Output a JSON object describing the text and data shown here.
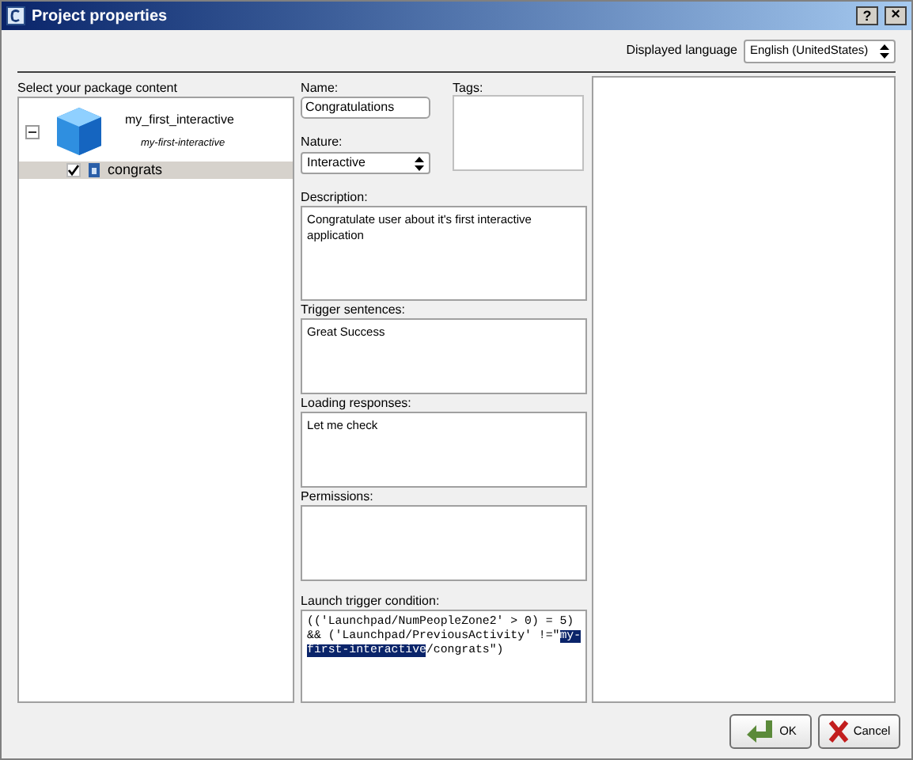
{
  "window": {
    "title": "Project properties",
    "help": "?",
    "close": "×"
  },
  "language": {
    "label": "Displayed language",
    "value": "English (UnitedStates)"
  },
  "package": {
    "label": "Select your package content",
    "tree": [
      {
        "name": "my_first_interactive",
        "subtitle": "my-first-interactive",
        "expanded": true,
        "children": [
          {
            "name": "congrats",
            "checked": true,
            "selected": true
          }
        ]
      }
    ]
  },
  "form": {
    "name": {
      "label": "Name:",
      "value": "Congratulations"
    },
    "tags": {
      "label": "Tags:"
    },
    "nature": {
      "label": "Nature:",
      "value": "Interactive"
    },
    "description": {
      "label": "Description:",
      "value": "Congratulate user about it's first interactive application"
    },
    "trigger_sentences": {
      "label": "Trigger sentences:",
      "value": "Great Success"
    },
    "loading_responses": {
      "label": "Loading responses:",
      "value": "Let me check"
    },
    "permissions": {
      "label": "Permissions:"
    },
    "launch_condition": {
      "label": "Launch trigger condition:",
      "before": "(('Launchpad/NumPeopleZone2' > 0) = 5) && ('Launchpad/PreviousActivity' !=\"",
      "selected": "my-first-interactive",
      "after": "/congrats\")"
    }
  },
  "buttons": [
    {
      "kind": "ok",
      "label": "OK"
    },
    {
      "kind": "cancel",
      "label": "Cancel"
    }
  ]
}
